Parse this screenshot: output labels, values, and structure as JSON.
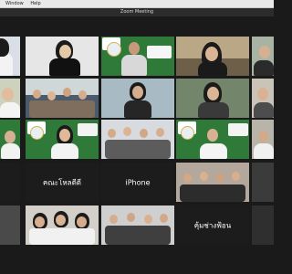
{
  "app": {
    "menu": [
      "Window",
      "Help"
    ],
    "title": "Zoom Meeting"
  },
  "participants": [
    {
      "id": "p1",
      "type": "video"
    },
    {
      "id": "p2",
      "type": "video"
    },
    {
      "id": "p3",
      "type": "video"
    },
    {
      "id": "p4",
      "type": "video"
    },
    {
      "id": "p5",
      "type": "video"
    },
    {
      "id": "p6",
      "type": "video"
    },
    {
      "id": "p7",
      "type": "video"
    },
    {
      "id": "p8",
      "type": "video"
    },
    {
      "id": "p9",
      "type": "video"
    },
    {
      "id": "p10",
      "type": "video"
    },
    {
      "id": "p11",
      "type": "video"
    },
    {
      "id": "p12",
      "type": "video"
    },
    {
      "id": "p13",
      "type": "video"
    },
    {
      "id": "p14",
      "type": "video"
    },
    {
      "id": "p15",
      "type": "video"
    },
    {
      "id": "p16",
      "type": "video"
    },
    {
      "id": "p17",
      "type": "video"
    },
    {
      "id": "p18",
      "type": "name",
      "name": "คณะโหลดีดี"
    },
    {
      "id": "p19",
      "type": "name",
      "name": "iPhone"
    },
    {
      "id": "p20",
      "type": "video"
    },
    {
      "id": "p21",
      "type": "video"
    },
    {
      "id": "p22",
      "type": "video"
    },
    {
      "id": "p23",
      "type": "video"
    },
    {
      "id": "p24",
      "type": "video"
    },
    {
      "id": "p25",
      "type": "name",
      "name": "คุ้มช่างฟ้อน"
    }
  ]
}
